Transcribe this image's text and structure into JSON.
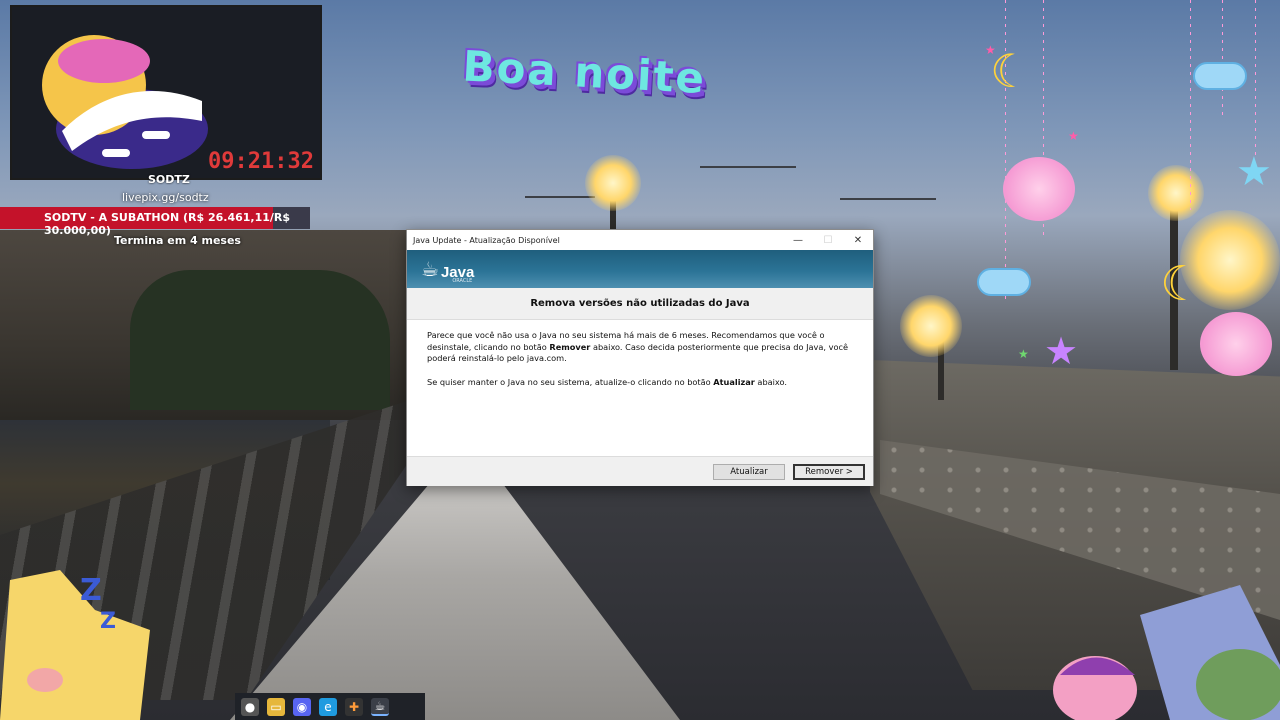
{
  "stream": {
    "clock": "09:21:32",
    "username": "SODTZ",
    "link": "livepix.gg/sodtz",
    "subathon": "SODTV - A SUBATHON (R$ 26.461,11/R$ 30.000,00)",
    "subathon_progress": 0.882,
    "ends": "Termina em 4 meses",
    "greeting": "Boa noite"
  },
  "dialog": {
    "title": "Java Update - Atualização Disponível",
    "logo_word": "Java",
    "logo_sub": "ORACLE",
    "heading": "Remova versões não utilizadas do Java",
    "para1_a": "Parece que você não usa o Java no seu sistema há mais de 6 meses. Recomendamos que você o desinstale, clicando no botão ",
    "para1_bold": "Remover",
    "para1_b": " abaixo. Caso decida posteriormente que precisa do Java, você poderá reinstalá-lo pelo java.com.",
    "para2_a": "Se quiser manter o Java no seu sistema, atualize-o clicando no botão ",
    "para2_bold": "Atualizar",
    "para2_b": " abaixo.",
    "btn_update": "Atualizar",
    "btn_remove": "Remover >",
    "minimize": "—",
    "maximize": "☐",
    "close": "✕"
  },
  "taskbar": {
    "icons": [
      "chat-icon",
      "folder-icon",
      "discord-icon",
      "edge-icon",
      "app-icon",
      "java-icon"
    ]
  },
  "colors": {
    "java_banner": "#2b7396",
    "subathon_bar": "#c4122a",
    "clock": "#e03a3a"
  }
}
